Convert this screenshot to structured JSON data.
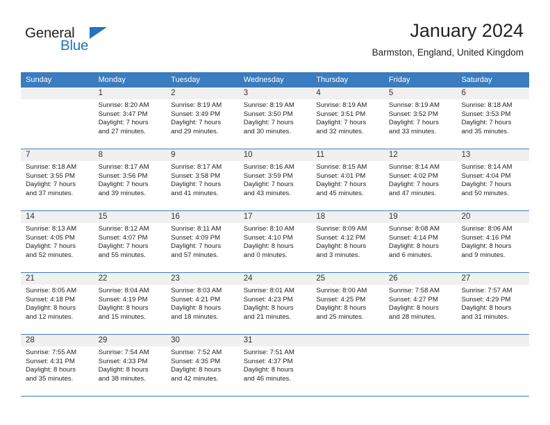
{
  "brand": {
    "word1": "General",
    "word2": "Blue",
    "accent_color": "#1f74bd",
    "triangle_icon": "brand-triangle-icon"
  },
  "header": {
    "title": "January 2024",
    "location": "Barmston, England, United Kingdom"
  },
  "calendar": {
    "header_bg": "#3a7cbe",
    "daynum_bg": "#f0f0f0",
    "weekdays": [
      "Sunday",
      "Monday",
      "Tuesday",
      "Wednesday",
      "Thursday",
      "Friday",
      "Saturday"
    ],
    "weeks": [
      [
        {
          "day": "",
          "empty": true,
          "lines": []
        },
        {
          "day": "1",
          "empty": false,
          "lines": [
            "Sunrise: 8:20 AM",
            "Sunset: 3:47 PM",
            "Daylight: 7 hours",
            "and 27 minutes."
          ]
        },
        {
          "day": "2",
          "empty": false,
          "lines": [
            "Sunrise: 8:19 AM",
            "Sunset: 3:49 PM",
            "Daylight: 7 hours",
            "and 29 minutes."
          ]
        },
        {
          "day": "3",
          "empty": false,
          "lines": [
            "Sunrise: 8:19 AM",
            "Sunset: 3:50 PM",
            "Daylight: 7 hours",
            "and 30 minutes."
          ]
        },
        {
          "day": "4",
          "empty": false,
          "lines": [
            "Sunrise: 8:19 AM",
            "Sunset: 3:51 PM",
            "Daylight: 7 hours",
            "and 32 minutes."
          ]
        },
        {
          "day": "5",
          "empty": false,
          "lines": [
            "Sunrise: 8:19 AM",
            "Sunset: 3:52 PM",
            "Daylight: 7 hours",
            "and 33 minutes."
          ]
        },
        {
          "day": "6",
          "empty": false,
          "lines": [
            "Sunrise: 8:18 AM",
            "Sunset: 3:53 PM",
            "Daylight: 7 hours",
            "and 35 minutes."
          ]
        }
      ],
      [
        {
          "day": "7",
          "empty": false,
          "lines": [
            "Sunrise: 8:18 AM",
            "Sunset: 3:55 PM",
            "Daylight: 7 hours",
            "and 37 minutes."
          ]
        },
        {
          "day": "8",
          "empty": false,
          "lines": [
            "Sunrise: 8:17 AM",
            "Sunset: 3:56 PM",
            "Daylight: 7 hours",
            "and 39 minutes."
          ]
        },
        {
          "day": "9",
          "empty": false,
          "lines": [
            "Sunrise: 8:17 AM",
            "Sunset: 3:58 PM",
            "Daylight: 7 hours",
            "and 41 minutes."
          ]
        },
        {
          "day": "10",
          "empty": false,
          "lines": [
            "Sunrise: 8:16 AM",
            "Sunset: 3:59 PM",
            "Daylight: 7 hours",
            "and 43 minutes."
          ]
        },
        {
          "day": "11",
          "empty": false,
          "lines": [
            "Sunrise: 8:15 AM",
            "Sunset: 4:01 PM",
            "Daylight: 7 hours",
            "and 45 minutes."
          ]
        },
        {
          "day": "12",
          "empty": false,
          "lines": [
            "Sunrise: 8:14 AM",
            "Sunset: 4:02 PM",
            "Daylight: 7 hours",
            "and 47 minutes."
          ]
        },
        {
          "day": "13",
          "empty": false,
          "lines": [
            "Sunrise: 8:14 AM",
            "Sunset: 4:04 PM",
            "Daylight: 7 hours",
            "and 50 minutes."
          ]
        }
      ],
      [
        {
          "day": "14",
          "empty": false,
          "lines": [
            "Sunrise: 8:13 AM",
            "Sunset: 4:05 PM",
            "Daylight: 7 hours",
            "and 52 minutes."
          ]
        },
        {
          "day": "15",
          "empty": false,
          "lines": [
            "Sunrise: 8:12 AM",
            "Sunset: 4:07 PM",
            "Daylight: 7 hours",
            "and 55 minutes."
          ]
        },
        {
          "day": "16",
          "empty": false,
          "lines": [
            "Sunrise: 8:11 AM",
            "Sunset: 4:09 PM",
            "Daylight: 7 hours",
            "and 57 minutes."
          ]
        },
        {
          "day": "17",
          "empty": false,
          "lines": [
            "Sunrise: 8:10 AM",
            "Sunset: 4:10 PM",
            "Daylight: 8 hours",
            "and 0 minutes."
          ]
        },
        {
          "day": "18",
          "empty": false,
          "lines": [
            "Sunrise: 8:09 AM",
            "Sunset: 4:12 PM",
            "Daylight: 8 hours",
            "and 3 minutes."
          ]
        },
        {
          "day": "19",
          "empty": false,
          "lines": [
            "Sunrise: 8:08 AM",
            "Sunset: 4:14 PM",
            "Daylight: 8 hours",
            "and 6 minutes."
          ]
        },
        {
          "day": "20",
          "empty": false,
          "lines": [
            "Sunrise: 8:06 AM",
            "Sunset: 4:16 PM",
            "Daylight: 8 hours",
            "and 9 minutes."
          ]
        }
      ],
      [
        {
          "day": "21",
          "empty": false,
          "lines": [
            "Sunrise: 8:05 AM",
            "Sunset: 4:18 PM",
            "Daylight: 8 hours",
            "and 12 minutes."
          ]
        },
        {
          "day": "22",
          "empty": false,
          "lines": [
            "Sunrise: 8:04 AM",
            "Sunset: 4:19 PM",
            "Daylight: 8 hours",
            "and 15 minutes."
          ]
        },
        {
          "day": "23",
          "empty": false,
          "lines": [
            "Sunrise: 8:03 AM",
            "Sunset: 4:21 PM",
            "Daylight: 8 hours",
            "and 18 minutes."
          ]
        },
        {
          "day": "24",
          "empty": false,
          "lines": [
            "Sunrise: 8:01 AM",
            "Sunset: 4:23 PM",
            "Daylight: 8 hours",
            "and 21 minutes."
          ]
        },
        {
          "day": "25",
          "empty": false,
          "lines": [
            "Sunrise: 8:00 AM",
            "Sunset: 4:25 PM",
            "Daylight: 8 hours",
            "and 25 minutes."
          ]
        },
        {
          "day": "26",
          "empty": false,
          "lines": [
            "Sunrise: 7:58 AM",
            "Sunset: 4:27 PM",
            "Daylight: 8 hours",
            "and 28 minutes."
          ]
        },
        {
          "day": "27",
          "empty": false,
          "lines": [
            "Sunrise: 7:57 AM",
            "Sunset: 4:29 PM",
            "Daylight: 8 hours",
            "and 31 minutes."
          ]
        }
      ],
      [
        {
          "day": "28",
          "empty": false,
          "lines": [
            "Sunrise: 7:55 AM",
            "Sunset: 4:31 PM",
            "Daylight: 8 hours",
            "and 35 minutes."
          ]
        },
        {
          "day": "29",
          "empty": false,
          "lines": [
            "Sunrise: 7:54 AM",
            "Sunset: 4:33 PM",
            "Daylight: 8 hours",
            "and 38 minutes."
          ]
        },
        {
          "day": "30",
          "empty": false,
          "lines": [
            "Sunrise: 7:52 AM",
            "Sunset: 4:35 PM",
            "Daylight: 8 hours",
            "and 42 minutes."
          ]
        },
        {
          "day": "31",
          "empty": false,
          "lines": [
            "Sunrise: 7:51 AM",
            "Sunset: 4:37 PM",
            "Daylight: 8 hours",
            "and 46 minutes."
          ]
        },
        {
          "day": "",
          "empty": true,
          "lines": []
        },
        {
          "day": "",
          "empty": true,
          "lines": []
        },
        {
          "day": "",
          "empty": true,
          "lines": []
        }
      ]
    ]
  }
}
